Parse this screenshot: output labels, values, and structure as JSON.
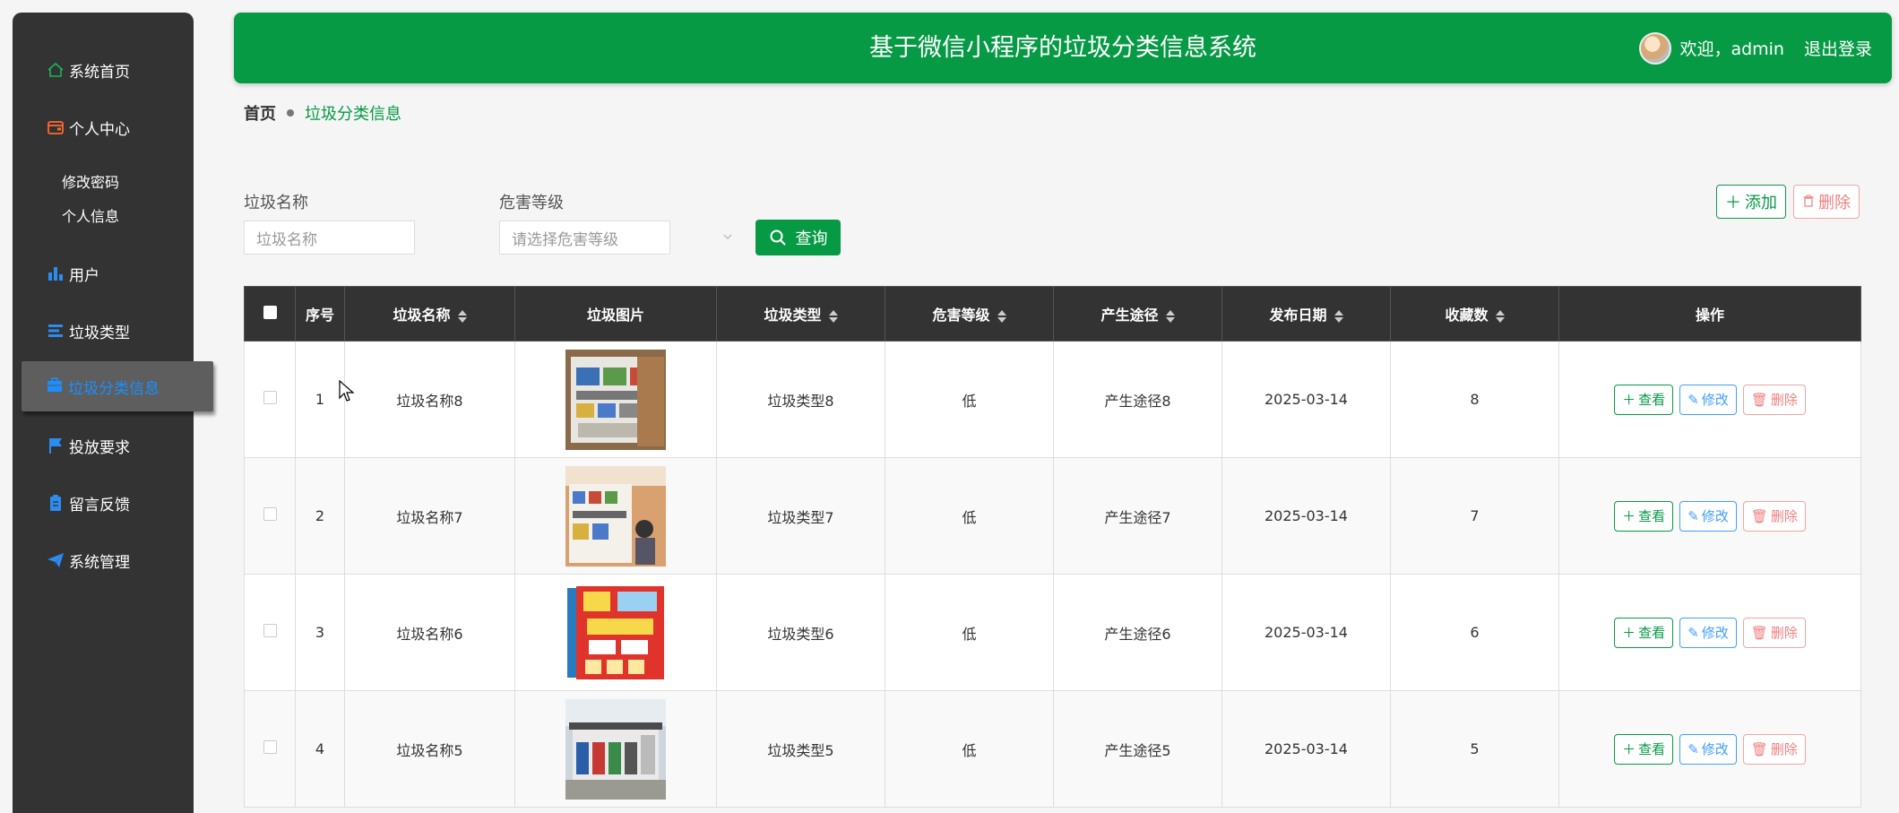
{
  "sidebar": {
    "items": [
      {
        "label": "系统首页",
        "icon": "home-icon"
      },
      {
        "label": "个人中心",
        "icon": "wallet-icon"
      },
      {
        "label": "用户",
        "icon": "bar-chart-icon"
      },
      {
        "label": "垃圾类型",
        "icon": "list-icon"
      },
      {
        "label": "垃圾分类信息",
        "icon": "briefcase-icon"
      },
      {
        "label": "投放要求",
        "icon": "flag-icon"
      },
      {
        "label": "留言反馈",
        "icon": "clipboard-icon"
      },
      {
        "label": "系统管理",
        "icon": "paper-plane-icon"
      }
    ],
    "sub_items": [
      "修改密码",
      "个人信息"
    ],
    "active_color": "#1890ff"
  },
  "header": {
    "title": "基于微信小程序的垃圾分类信息系统",
    "welcome": "欢迎，admin",
    "logout": "退出登录",
    "bg_color": "#079a45"
  },
  "breadcrumb": {
    "home": "首页",
    "current": "垃圾分类信息"
  },
  "search": {
    "name_label": "垃圾名称",
    "name_placeholder": "垃圾名称",
    "level_label": "危害等级",
    "level_placeholder": "请选择危害等级",
    "query_button": "查询"
  },
  "actions": {
    "add": "添加",
    "delete": "删除"
  },
  "table": {
    "headers": [
      "序号",
      "垃圾名称",
      "垃圾图片",
      "垃圾类型",
      "危害等级",
      "产生途径",
      "发布日期",
      "收藏数",
      "操作"
    ],
    "rows": [
      {
        "index": "1",
        "name": "垃圾名称8",
        "type": "垃圾类型8",
        "level": "低",
        "source": "产生途径8",
        "date": "2025-03-14",
        "favorites": "8"
      },
      {
        "index": "2",
        "name": "垃圾名称7",
        "type": "垃圾类型7",
        "level": "低",
        "source": "产生途径7",
        "date": "2025-03-14",
        "favorites": "7"
      },
      {
        "index": "3",
        "name": "垃圾名称6",
        "type": "垃圾类型6",
        "level": "低",
        "source": "产生途径6",
        "date": "2025-03-14",
        "favorites": "6"
      },
      {
        "index": "4",
        "name": "垃圾名称5",
        "type": "垃圾类型5",
        "level": "低",
        "source": "产生途径5",
        "date": "2025-03-14",
        "favorites": "5"
      }
    ],
    "row_actions": {
      "view": "查看",
      "edit": "修改",
      "delete": "删除"
    }
  }
}
